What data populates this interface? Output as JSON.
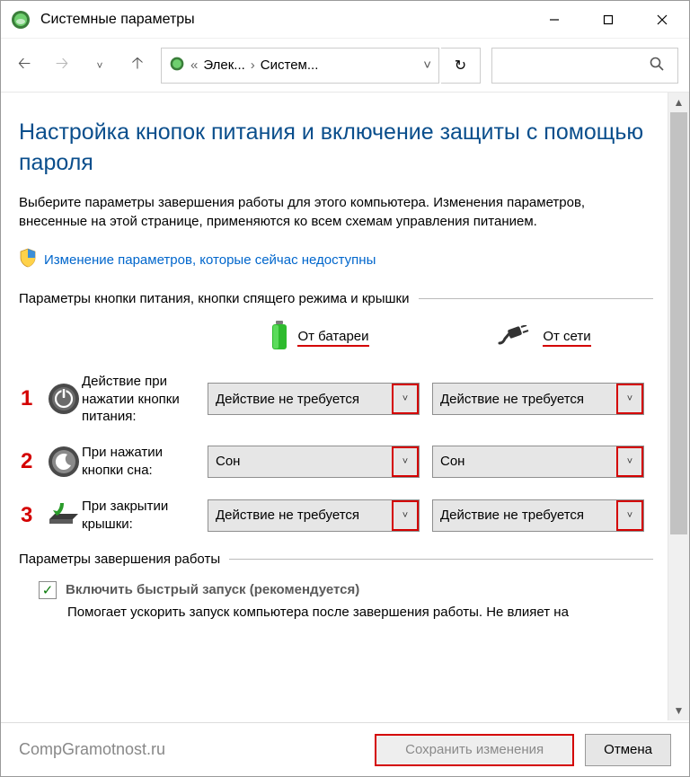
{
  "window": {
    "title": "Системные параметры"
  },
  "breadcrumb": {
    "seg1": "Элек...",
    "seg2": "Систем..."
  },
  "heading": "Настройка кнопок питания и включение защиты с помощью пароля",
  "description": "Выберите параметры завершения работы для этого компьютера. Изменения параметров, внесенные на этой странице, применяются ко всем схемам управления питанием.",
  "uac_link": "Изменение параметров, которые сейчас недоступны",
  "section_buttons": "Параметры кнопки питания, кнопки спящего режима и крышки",
  "columns": {
    "battery": "От батареи",
    "plugged": "От сети"
  },
  "rows": [
    {
      "num": "1",
      "label": "Действие при нажатии кнопки питания:",
      "battery": "Действие не требуется",
      "plugged": "Действие не требуется"
    },
    {
      "num": "2",
      "label": "При нажатии кнопки сна:",
      "battery": "Сон",
      "plugged": "Сон"
    },
    {
      "num": "3",
      "label": "При закрытии крышки:",
      "battery": "Действие не требуется",
      "plugged": "Действие не требуется"
    }
  ],
  "section_shutdown": "Параметры завершения работы",
  "fast_startup": {
    "label": "Включить быстрый запуск (рекомендуется)",
    "desc": "Помогает ускорить запуск компьютера после завершения работы. Не влияет на"
  },
  "footer": {
    "watermark": "CompGramotnost.ru",
    "save": "Сохранить изменения",
    "cancel": "Отмена"
  }
}
